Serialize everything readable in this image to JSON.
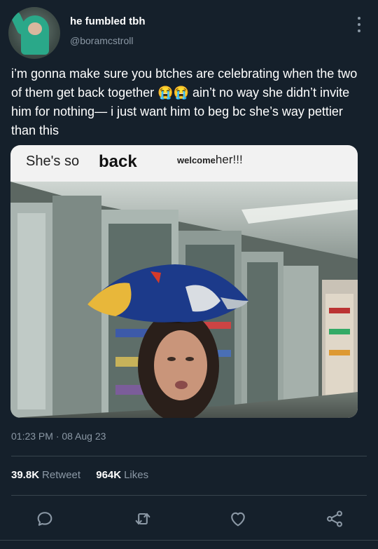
{
  "author": {
    "display_name": "he fumbled tbh",
    "handle": "@boramcstroll",
    "avatar_icon": "avatar-photo"
  },
  "tweet": {
    "text": "i’m gonna make sure you btches are celebrating when the two of them get back together 😭😭  ain’t no way she didn’t invite him for nothing— i just want him to beg bc she’s way pettier than this",
    "timestamp": "01:23 PM · 08 Aug 23"
  },
  "media": {
    "caption_part1": "She's so",
    "caption_part2": "back",
    "caption_part3_small": "welcome",
    "caption_part3_large": "her!!!"
  },
  "stats": {
    "retweets_count": "39.8K",
    "retweets_label": "Retweet",
    "likes_count": "964K",
    "likes_label": "Likes"
  },
  "actions": {
    "reply_icon": "reply-icon",
    "retweet_icon": "retweet-icon",
    "like_icon": "heart-icon",
    "share_icon": "share-icon"
  },
  "colors": {
    "background": "#15202b",
    "muted_text": "#8b98a5",
    "divider": "#38444d"
  }
}
